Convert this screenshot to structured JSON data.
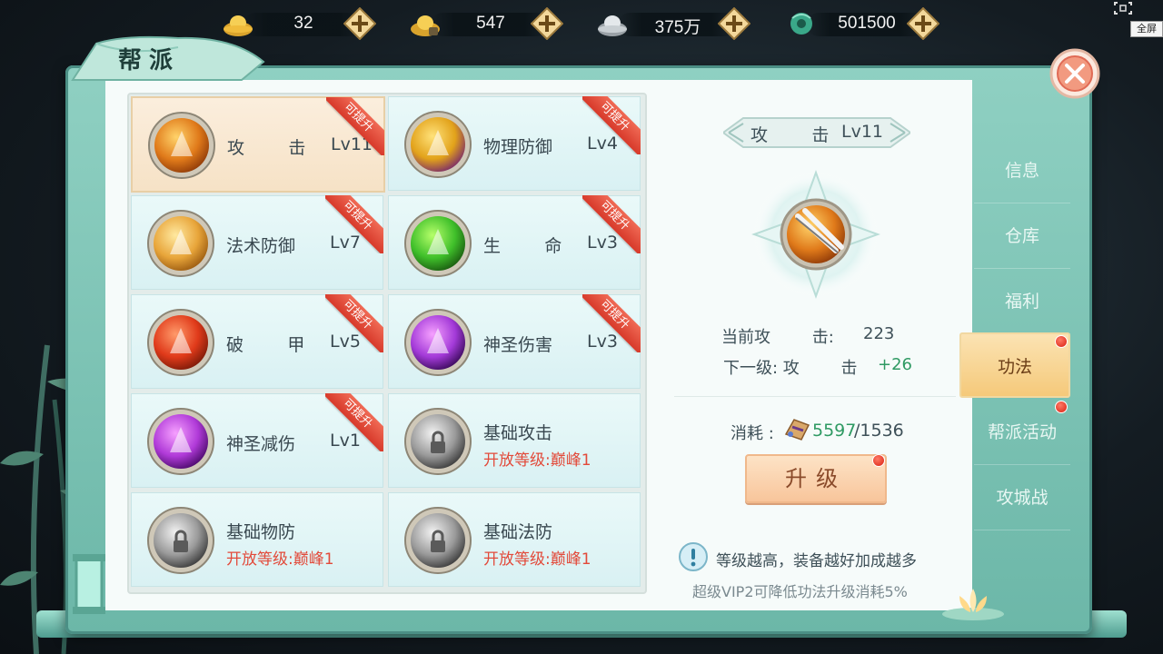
{
  "currencies": [
    {
      "icon": "gold-ingot-icon",
      "value": "32"
    },
    {
      "icon": "bound-gold-ingot-icon",
      "value": "547"
    },
    {
      "icon": "silver-ingot-icon",
      "value": "375万"
    },
    {
      "icon": "jade-icon",
      "value": "501500"
    }
  ],
  "fullscreen_label": "全屏",
  "panel_title": "帮派",
  "skills": [
    {
      "name": "攻        击",
      "level": "Lv11",
      "badge": "可提升",
      "icon": "attack-skill-icon",
      "selected": true
    },
    {
      "name": "物理防御",
      "level": "Lv4",
      "badge": "可提升",
      "icon": "physical-defense-skill-icon"
    },
    {
      "name": "法术防御",
      "level": "Lv7",
      "badge": "可提升",
      "icon": "magic-defense-skill-icon"
    },
    {
      "name": "生        命",
      "level": "Lv3",
      "badge": "可提升",
      "icon": "life-skill-icon"
    },
    {
      "name": "破        甲",
      "level": "Lv5",
      "badge": "可提升",
      "icon": "armor-break-skill-icon"
    },
    {
      "name": "神圣伤害",
      "level": "Lv3",
      "badge": "可提升",
      "icon": "holy-damage-skill-icon"
    },
    {
      "name": "神圣减伤",
      "level": "Lv1",
      "badge": "可提升",
      "icon": "holy-reduction-skill-icon"
    },
    {
      "name": "基础攻击",
      "unlock": "开放等级:巅峰1",
      "icon": "locked-skill-icon"
    },
    {
      "name": "基础物防",
      "unlock": "开放等级:巅峰1",
      "icon": "locked-skill-icon"
    },
    {
      "name": "基础法防",
      "unlock": "开放等级:巅峰1",
      "icon": "locked-skill-icon"
    }
  ],
  "detail": {
    "name": "攻        击",
    "level": "Lv11",
    "current_label": "当前攻        击:",
    "current_value": "223",
    "next_label": "下一级: 攻        击",
    "next_value": "+26",
    "cost_label": "消耗 :",
    "cost_have": "5597",
    "cost_need": "/1536",
    "upgrade_label": "升级",
    "tip": "等级越高，装备越好加成越多",
    "vip_note": "超级VIP2可降低功法升级消耗5%"
  },
  "tabs": [
    {
      "label": "信息"
    },
    {
      "label": "仓库"
    },
    {
      "label": "福利"
    },
    {
      "label": "功法",
      "active": true,
      "dot": true
    },
    {
      "label": "帮派活动",
      "dot": true
    },
    {
      "label": "攻城战"
    }
  ],
  "colors": {
    "frame": "#8fd0c2",
    "selected_card": "#fbeedd",
    "badge": "#d7392a",
    "green_value": "#2f9a63",
    "unlock_red": "#e24a3a",
    "active_tab": "#f5c97a"
  }
}
